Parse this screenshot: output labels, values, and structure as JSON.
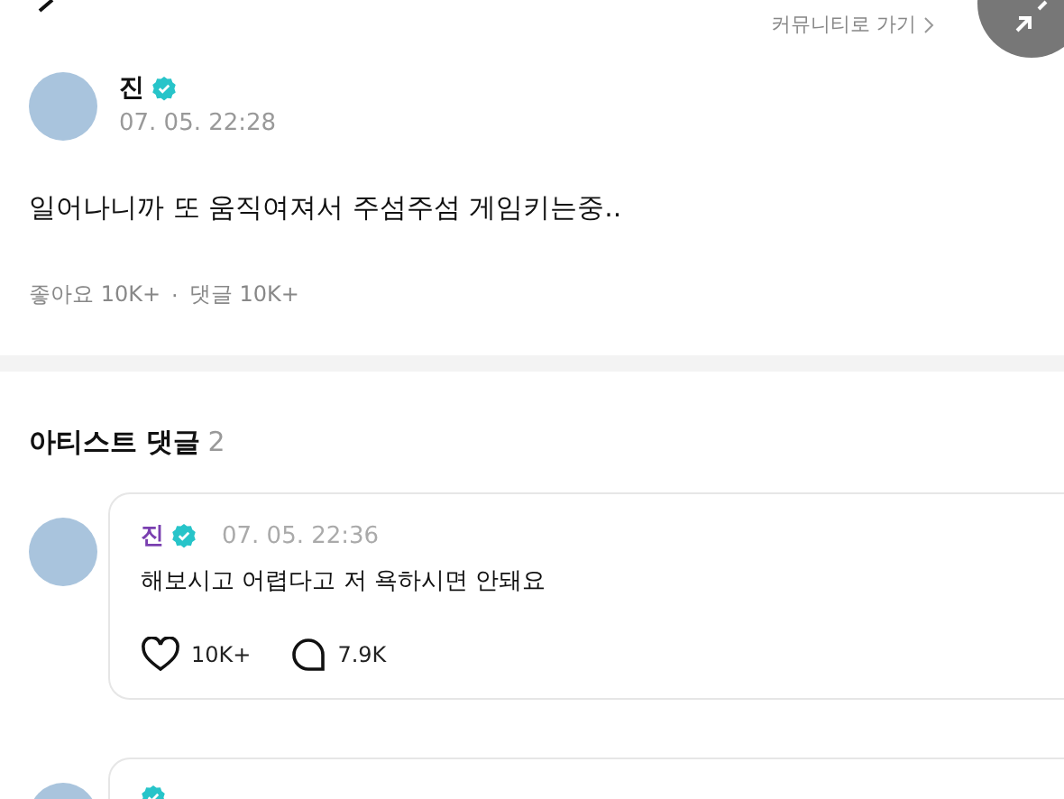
{
  "top_bar": {
    "community_link": "커뮤니티로 가기"
  },
  "post": {
    "author": "진",
    "verified": true,
    "time": "07. 05. 22:28",
    "text": "일어나니까 또 움직여져서 주섬주섬 게임키는중..",
    "likes_label": "좋아요",
    "likes": "10K+",
    "separator": "·",
    "comments_label": "댓글",
    "comments": "10K+"
  },
  "artist_comments": {
    "title": "아티스트 댓글",
    "count": "2",
    "items": [
      {
        "author": "진",
        "verified": true,
        "time": "07. 05. 22:36",
        "text": "해보시고 어렵다고 저 욕하시면 안돼요",
        "likes": "10K+",
        "replies": "7.9K"
      },
      {
        "verified": true
      }
    ]
  }
}
